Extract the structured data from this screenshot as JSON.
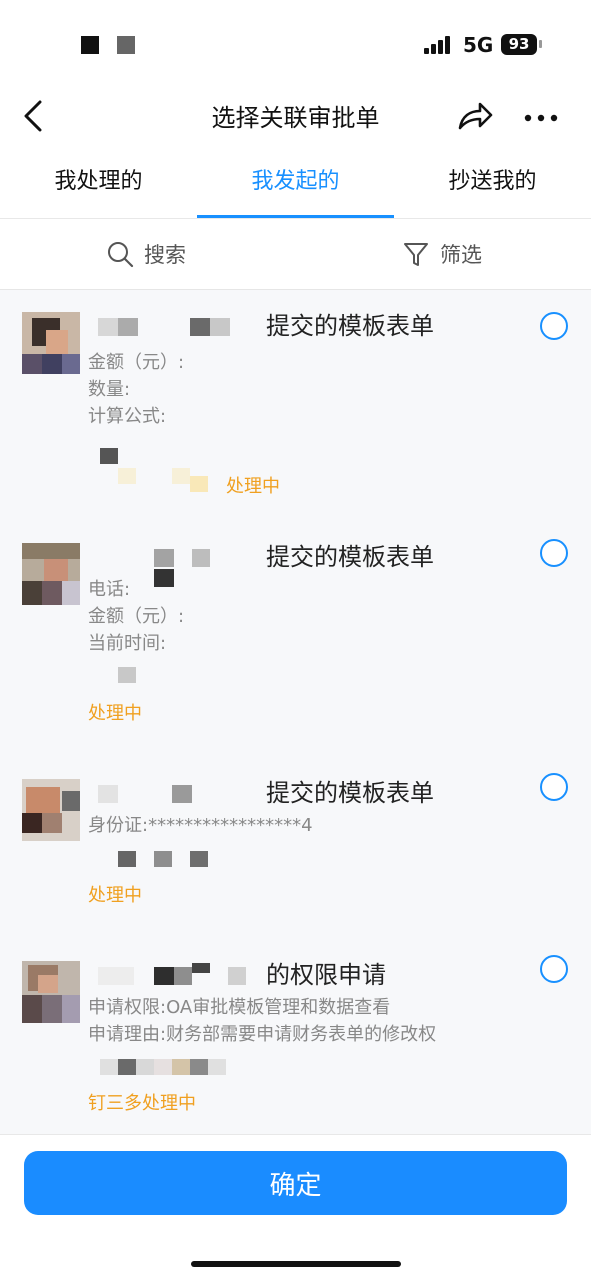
{
  "status_bar": {
    "network": "5G",
    "battery": "93"
  },
  "nav": {
    "title": "选择关联审批单"
  },
  "tabs": [
    {
      "label": "我处理的"
    },
    {
      "label": "我发起的"
    },
    {
      "label": "抄送我的"
    }
  ],
  "filter": {
    "search_label": "搜索",
    "filter_label": "筛选"
  },
  "cards": [
    {
      "title": "提交的模板表单",
      "fields": [
        "金额（元）:",
        "数量:",
        "计算公式:"
      ],
      "status": "处理中"
    },
    {
      "title": "提交的模板表单",
      "fields": [
        "电话:",
        "金额（元）:",
        "当前时间:"
      ],
      "status": "处理中"
    },
    {
      "title": "提交的模板表单",
      "fields": [
        "身份证:*****************4"
      ],
      "status": "处理中"
    },
    {
      "title": "的权限申请",
      "fields": [
        "申请权限:OA审批模板管理和数据查看",
        "申请理由:财务部需要申请财务表单的修改权"
      ],
      "status": "钉三多处理中"
    }
  ],
  "footer": {
    "confirm_label": "确定"
  },
  "colors": {
    "accent": "#1890ff",
    "status_orange": "#f0a020",
    "button_blue": "#1a8cff"
  }
}
